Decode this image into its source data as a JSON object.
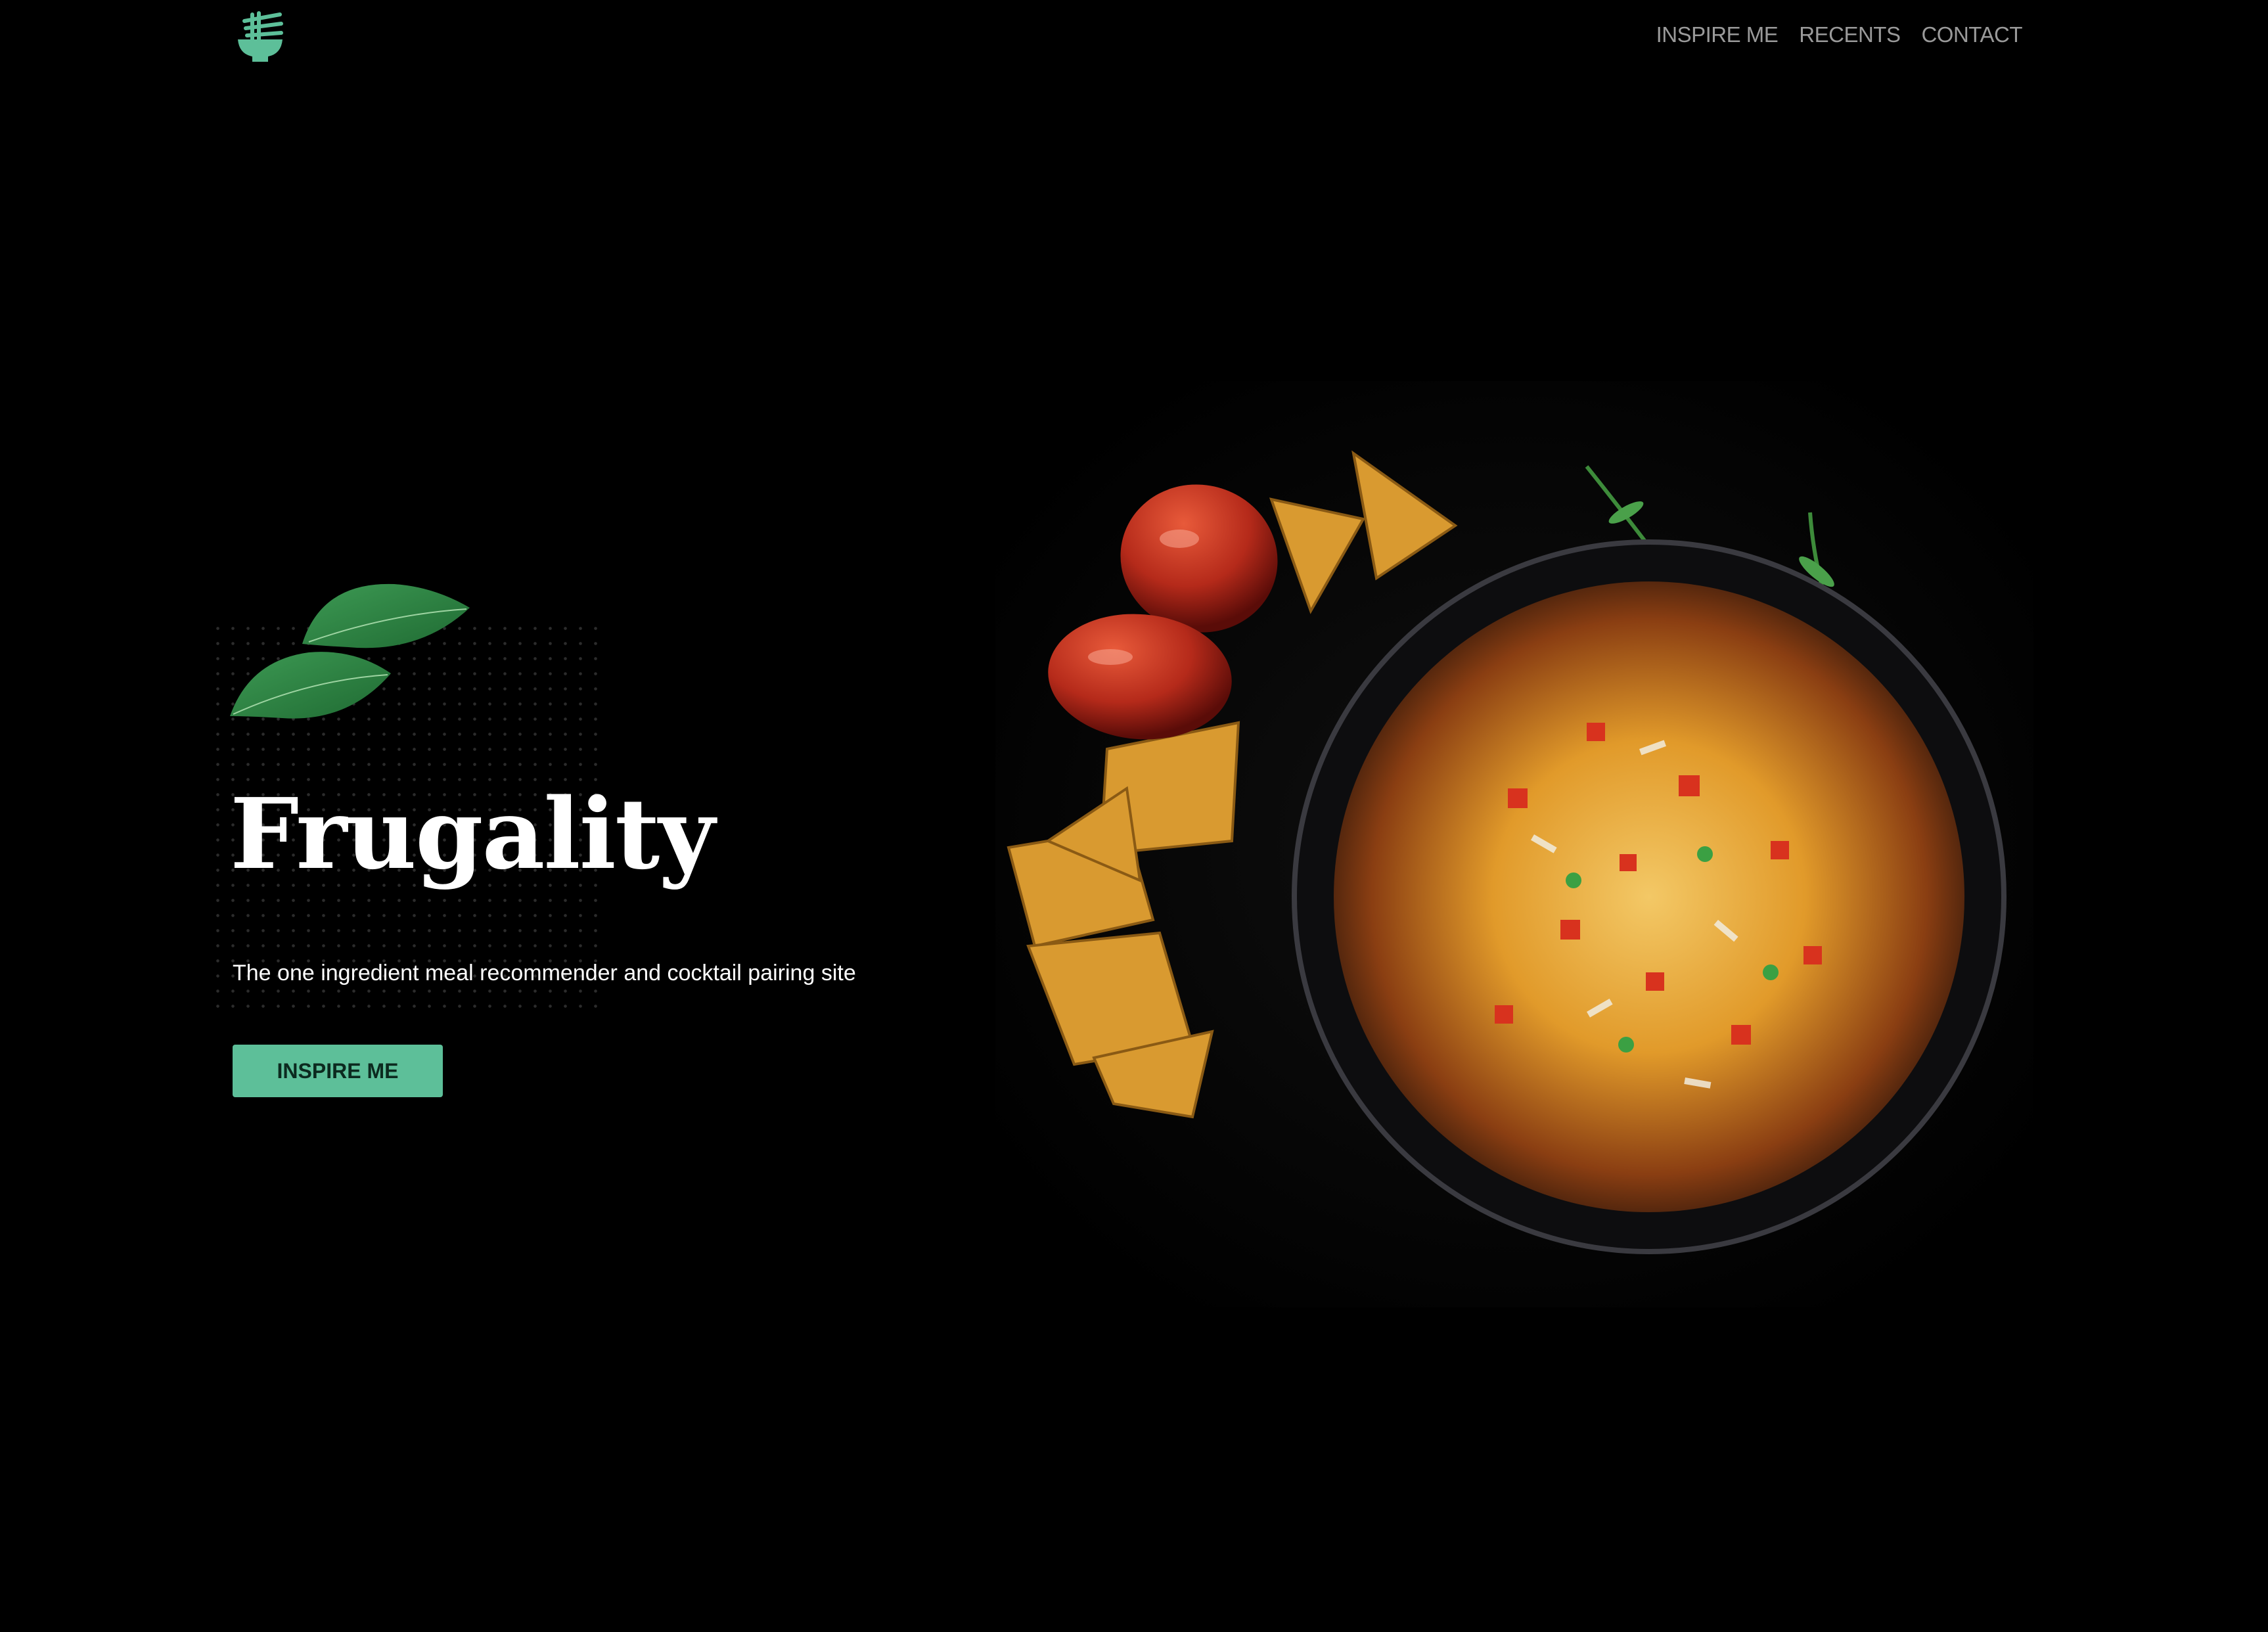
{
  "header": {
    "logo_icon": "bowl-with-chopsticks-icon",
    "nav": [
      {
        "label": "INSPIRE ME"
      },
      {
        "label": "RECENTS"
      },
      {
        "label": "CONTACT"
      }
    ]
  },
  "hero": {
    "title": "Frugality",
    "subtitle": "The one ingredient meal recommender and cocktail pairing site",
    "cta_label": "INSPIRE ME",
    "image_subject": "nachos-bowl-with-tomatoes-and-herbs"
  },
  "colors": {
    "background": "#000000",
    "accent": "#5dbf99",
    "nav_text": "#9a9a9a",
    "text": "#ffffff"
  }
}
